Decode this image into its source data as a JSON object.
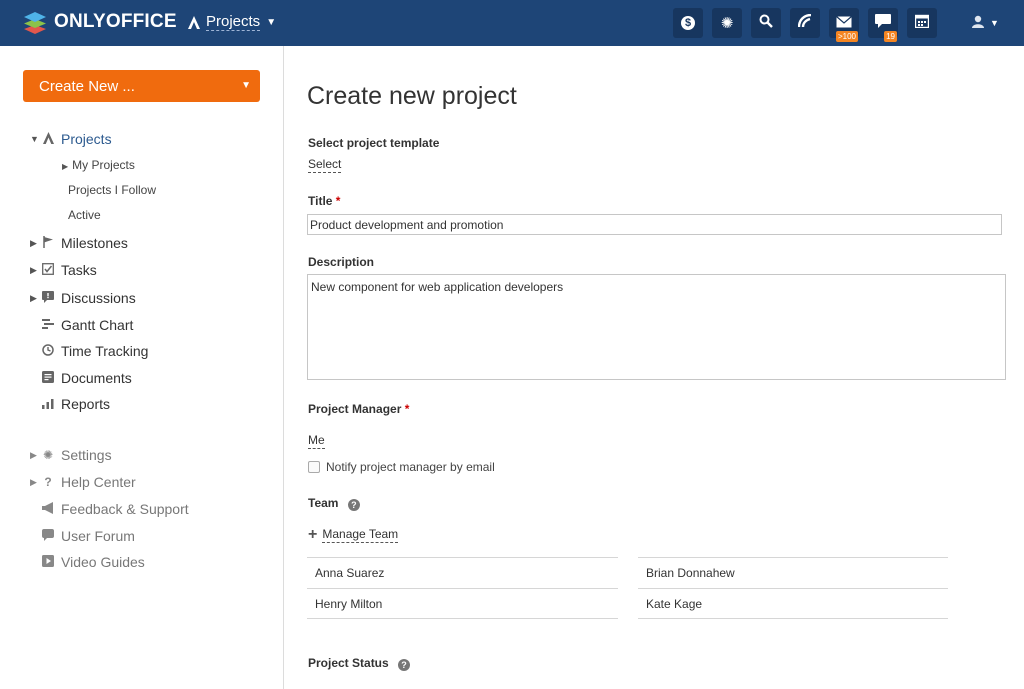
{
  "header": {
    "brand": "ONLYOFFICE",
    "module": "Projects",
    "icons": [
      {
        "name": "payments-icon",
        "glyph": "$",
        "badge": ""
      },
      {
        "name": "settings-icon",
        "glyph": "✺",
        "badge": ""
      },
      {
        "name": "search-icon",
        "glyph": "⚲",
        "badge": ""
      },
      {
        "name": "feed-icon",
        "glyph": "◜",
        "badge": ""
      },
      {
        "name": "mail-icon",
        "glyph": "✉",
        "badge": ">100"
      },
      {
        "name": "chat-icon",
        "glyph": "▬",
        "badge": "19"
      },
      {
        "name": "calendar-icon",
        "glyph": "▦",
        "badge": ""
      }
    ],
    "colors": {
      "bar": "#1e4577",
      "button": "#17365f",
      "badge": "#f48522"
    }
  },
  "sidebar": {
    "create_label": "Create New ...",
    "projects_label": "Projects",
    "sub_items": [
      "My Projects",
      "Projects I Follow",
      "Active"
    ],
    "items": [
      {
        "label": "Milestones"
      },
      {
        "label": "Tasks"
      },
      {
        "label": "Discussions"
      },
      {
        "label": "Gantt Chart"
      },
      {
        "label": "Time Tracking"
      },
      {
        "label": "Documents"
      },
      {
        "label": "Reports"
      }
    ],
    "bottom_items": [
      {
        "label": "Settings"
      },
      {
        "label": "Help Center"
      },
      {
        "label": "Feedback & Support"
      },
      {
        "label": "User Forum"
      },
      {
        "label": "Video Guides"
      }
    ]
  },
  "main": {
    "title": "Create new project",
    "template_label": "Select project template",
    "template_link": "Select",
    "title_label": "Title",
    "title_value": "Product development and promotion",
    "description_label": "Description",
    "description_value": "New component for web application developers",
    "manager_label": "Project Manager",
    "manager_value": "Me",
    "notify_label": "Notify project manager by email",
    "team_label": "Team",
    "manage_team_label": "Manage Team",
    "team_members": [
      "Anna Suarez",
      "Brian Donnahew",
      "Henry Milton",
      "Kate Kage"
    ],
    "status_label": "Project Status",
    "required_mark": "*"
  }
}
